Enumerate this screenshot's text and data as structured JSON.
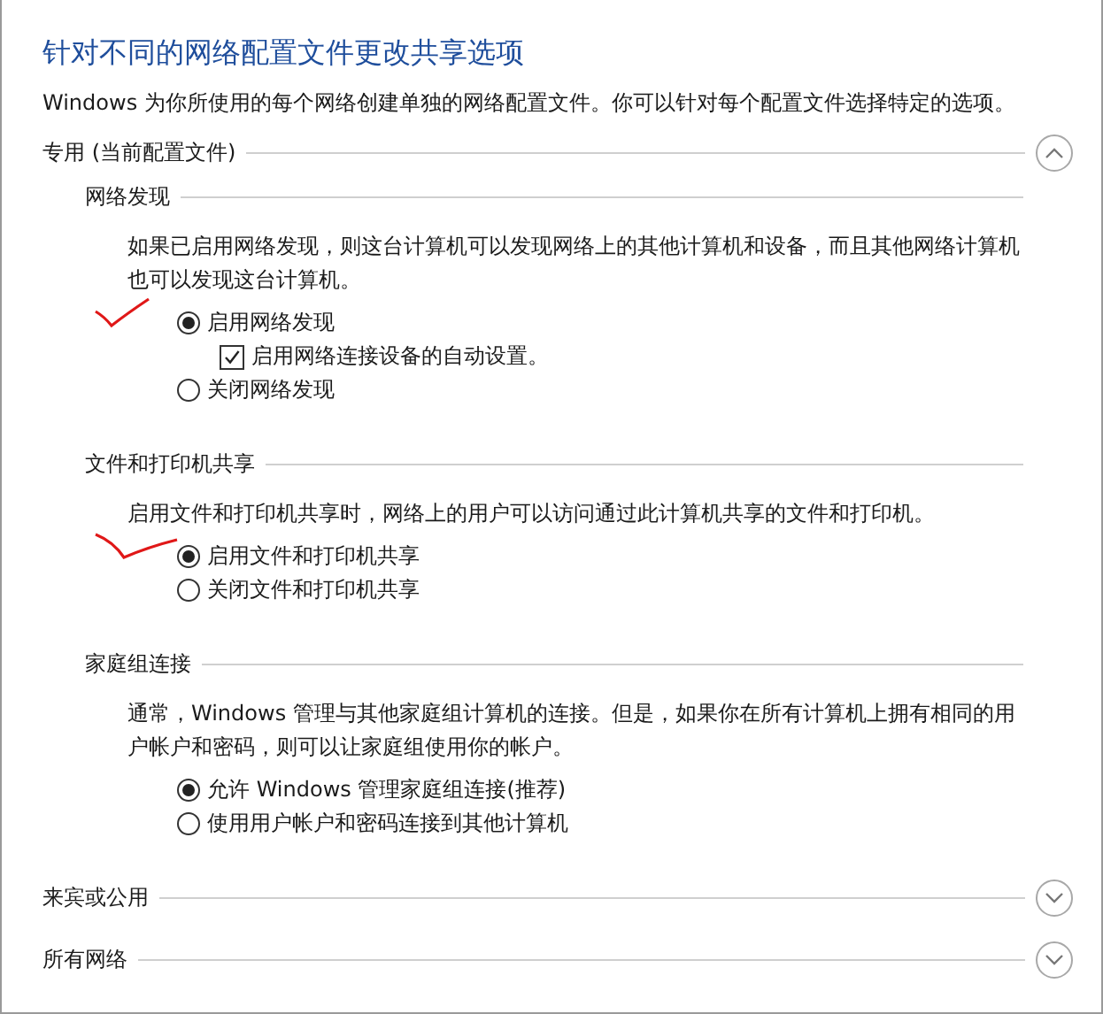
{
  "title": "针对不同的网络配置文件更改共享选项",
  "description": "Windows 为你所使用的每个网络创建单独的网络配置文件。你可以针对每个配置文件选择特定的选项。",
  "sections": [
    {
      "label": "专用 (当前配置文件)",
      "expanded": true,
      "groups": [
        {
          "heading": "网络发现",
          "text": "如果已启用网络发现，则这台计算机可以发现网络上的其他计算机和设备，而且其他网络计算机也可以发现这台计算机。",
          "options": [
            {
              "kind": "radio",
              "label": "启用网络发现",
              "selected": true,
              "pen_mark": true
            },
            {
              "kind": "checkbox",
              "label": "启用网络连接设备的自动设置。",
              "checked": true
            },
            {
              "kind": "radio",
              "label": "关闭网络发现",
              "selected": false
            }
          ]
        },
        {
          "heading": "文件和打印机共享",
          "text": "启用文件和打印机共享时，网络上的用户可以访问通过此计算机共享的文件和打印机。",
          "options": [
            {
              "kind": "radio",
              "label": "启用文件和打印机共享",
              "selected": true,
              "pen_mark": true
            },
            {
              "kind": "radio",
              "label": "关闭文件和打印机共享",
              "selected": false
            }
          ]
        },
        {
          "heading": "家庭组连接",
          "text": "通常，Windows 管理与其他家庭组计算机的连接。但是，如果你在所有计算机上拥有相同的用户帐户和密码，则可以让家庭组使用你的帐户。",
          "options": [
            {
              "kind": "radio",
              "label": "允许 Windows 管理家庭组连接(推荐)",
              "selected": true
            },
            {
              "kind": "radio",
              "label": "使用用户帐户和密码连接到其他计算机",
              "selected": false
            }
          ]
        }
      ]
    },
    {
      "label": "来宾或公用",
      "expanded": false
    },
    {
      "label": "所有网络",
      "expanded": false
    }
  ]
}
